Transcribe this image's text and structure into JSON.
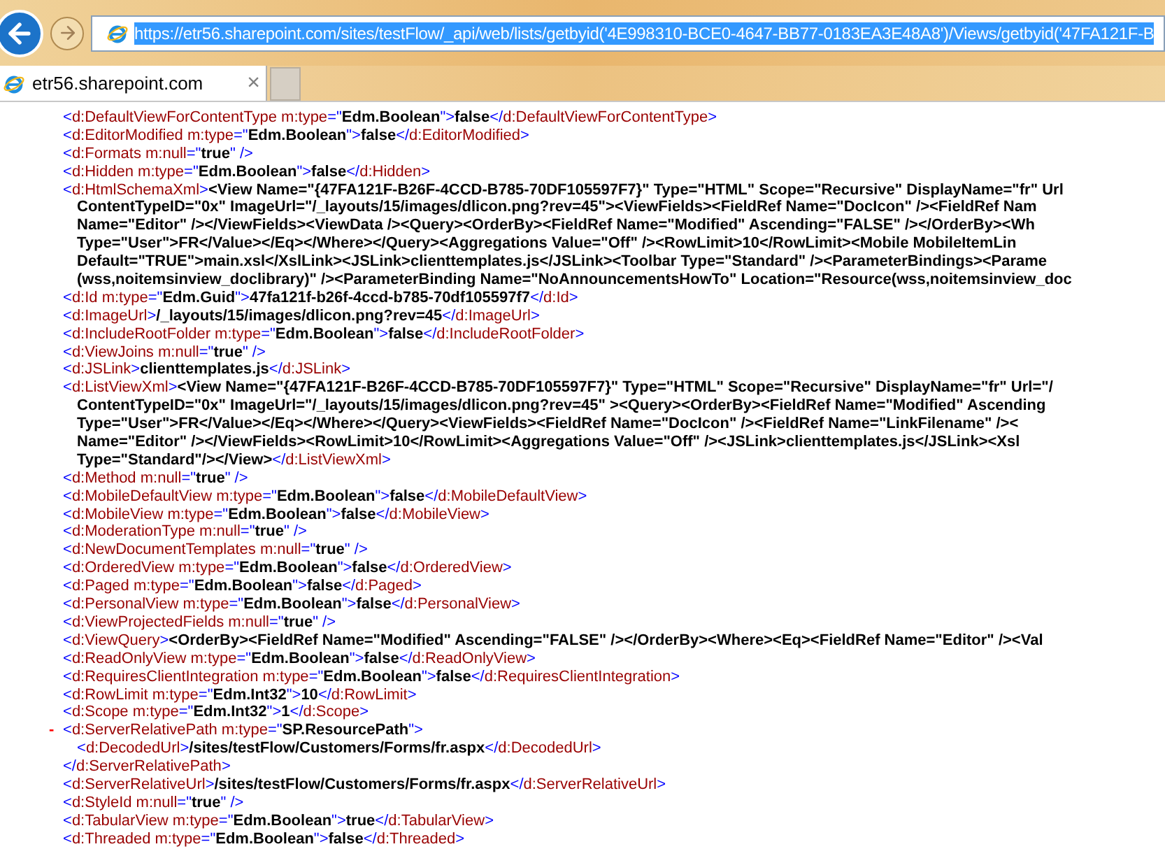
{
  "address_bar": {
    "url": "https://etr56.sharepoint.com/sites/testFlow/_api/web/lists/getbyid('4E998310-BCE0-4647-BB77-0183EA3E48A8')/Views/getbyid('47FA121F-B",
    "selected": true
  },
  "tabs": [
    {
      "title": "etr56.sharepoint.com",
      "close": "×",
      "selected": true
    }
  ],
  "xml_lines": [
    {
      "tokens": [
        {
          "kind": "markup",
          "text": "<"
        },
        {
          "kind": "name",
          "text": "d:DefaultViewForContentType m:type"
        },
        {
          "kind": "markup",
          "text": "=\""
        },
        {
          "kind": "value",
          "text": "Edm.Boolean"
        },
        {
          "kind": "markup",
          "text": "\">"
        },
        {
          "kind": "value",
          "text": "false"
        },
        {
          "kind": "markup",
          "text": "</"
        },
        {
          "kind": "name",
          "text": "d:DefaultViewForContentType"
        },
        {
          "kind": "markup",
          "text": ">"
        }
      ]
    },
    {
      "tokens": [
        {
          "kind": "markup",
          "text": "<"
        },
        {
          "kind": "name",
          "text": "d:EditorModified m:type"
        },
        {
          "kind": "markup",
          "text": "=\""
        },
        {
          "kind": "value",
          "text": "Edm.Boolean"
        },
        {
          "kind": "markup",
          "text": "\">"
        },
        {
          "kind": "value",
          "text": "false"
        },
        {
          "kind": "markup",
          "text": "</"
        },
        {
          "kind": "name",
          "text": "d:EditorModified"
        },
        {
          "kind": "markup",
          "text": ">"
        }
      ]
    },
    {
      "tokens": [
        {
          "kind": "markup",
          "text": "<"
        },
        {
          "kind": "name",
          "text": "d:Formats m:null"
        },
        {
          "kind": "markup",
          "text": "=\""
        },
        {
          "kind": "value",
          "text": "true"
        },
        {
          "kind": "markup",
          "text": "\" />"
        }
      ]
    },
    {
      "tokens": [
        {
          "kind": "markup",
          "text": "<"
        },
        {
          "kind": "name",
          "text": "d:Hidden m:type"
        },
        {
          "kind": "markup",
          "text": "=\""
        },
        {
          "kind": "value",
          "text": "Edm.Boolean"
        },
        {
          "kind": "markup",
          "text": "\">"
        },
        {
          "kind": "value",
          "text": "false"
        },
        {
          "kind": "markup",
          "text": "</"
        },
        {
          "kind": "name",
          "text": "d:Hidden"
        },
        {
          "kind": "markup",
          "text": ">"
        }
      ]
    },
    {
      "tokens": [
        {
          "kind": "markup",
          "text": "<"
        },
        {
          "kind": "name",
          "text": "d:HtmlSchemaXml"
        },
        {
          "kind": "markup",
          "text": ">"
        },
        {
          "kind": "value",
          "text": "<View Name=\"{47FA121F-B26F-4CCD-B785-70DF105597F7}\" Type=\"HTML\" Scope=\"Recursive\" DisplayName=\"fr\" Url"
        }
      ],
      "children": [
        {
          "tokens": [
            {
              "kind": "value",
              "text": "ContentTypeID=\"0x\" ImageUrl=\"/_layouts/15/images/dlicon.png?rev=45\"><ViewFields><FieldRef Name=\"DocIcon\" /><FieldRef Nam"
            }
          ]
        },
        {
          "tokens": [
            {
              "kind": "value",
              "text": "Name=\"Editor\" /></ViewFields><ViewData /><Query><OrderBy><FieldRef Name=\"Modified\" Ascending=\"FALSE\" /></OrderBy><Wh"
            }
          ]
        },
        {
          "tokens": [
            {
              "kind": "value",
              "text": "Type=\"User\">FR</Value></Eq></Where></Query><Aggregations Value=\"Off\" /><RowLimit>10</RowLimit><Mobile MobileItemLin"
            }
          ]
        },
        {
          "tokens": [
            {
              "kind": "value",
              "text": "Default=\"TRUE\">main.xsl</XslLink><JSLink>clienttemplates.js</JSLink><Toolbar Type=\"Standard\" /><ParameterBindings><Parame"
            }
          ]
        },
        {
          "tokens": [
            {
              "kind": "value",
              "text": "(wss,noitemsinview_doclibrary)\" /><ParameterBinding Name=\"NoAnnouncementsHowTo\" Location=\"Resource(wss,noitemsinview_doc"
            }
          ]
        }
      ]
    },
    {
      "tokens": [
        {
          "kind": "markup",
          "text": "<"
        },
        {
          "kind": "name",
          "text": "d:Id m:type"
        },
        {
          "kind": "markup",
          "text": "=\""
        },
        {
          "kind": "value",
          "text": "Edm.Guid"
        },
        {
          "kind": "markup",
          "text": "\">"
        },
        {
          "kind": "value",
          "text": "47fa121f-b26f-4ccd-b785-70df105597f7"
        },
        {
          "kind": "markup",
          "text": "</"
        },
        {
          "kind": "name",
          "text": "d:Id"
        },
        {
          "kind": "markup",
          "text": ">"
        }
      ]
    },
    {
      "tokens": [
        {
          "kind": "markup",
          "text": "<"
        },
        {
          "kind": "name",
          "text": "d:ImageUrl"
        },
        {
          "kind": "markup",
          "text": ">"
        },
        {
          "kind": "value",
          "text": "/_layouts/15/images/dlicon.png?rev=45"
        },
        {
          "kind": "markup",
          "text": "</"
        },
        {
          "kind": "name",
          "text": "d:ImageUrl"
        },
        {
          "kind": "markup",
          "text": ">"
        }
      ]
    },
    {
      "tokens": [
        {
          "kind": "markup",
          "text": "<"
        },
        {
          "kind": "name",
          "text": "d:IncludeRootFolder m:type"
        },
        {
          "kind": "markup",
          "text": "=\""
        },
        {
          "kind": "value",
          "text": "Edm.Boolean"
        },
        {
          "kind": "markup",
          "text": "\">"
        },
        {
          "kind": "value",
          "text": "false"
        },
        {
          "kind": "markup",
          "text": "</"
        },
        {
          "kind": "name",
          "text": "d:IncludeRootFolder"
        },
        {
          "kind": "markup",
          "text": ">"
        }
      ]
    },
    {
      "tokens": [
        {
          "kind": "markup",
          "text": "<"
        },
        {
          "kind": "name",
          "text": "d:ViewJoins m:null"
        },
        {
          "kind": "markup",
          "text": "=\""
        },
        {
          "kind": "value",
          "text": "true"
        },
        {
          "kind": "markup",
          "text": "\" />"
        }
      ]
    },
    {
      "tokens": [
        {
          "kind": "markup",
          "text": "<"
        },
        {
          "kind": "name",
          "text": "d:JSLink"
        },
        {
          "kind": "markup",
          "text": ">"
        },
        {
          "kind": "value",
          "text": "clienttemplates.js"
        },
        {
          "kind": "markup",
          "text": "</"
        },
        {
          "kind": "name",
          "text": "d:JSLink"
        },
        {
          "kind": "markup",
          "text": ">"
        }
      ]
    },
    {
      "tokens": [
        {
          "kind": "markup",
          "text": "<"
        },
        {
          "kind": "name",
          "text": "d:ListViewXml"
        },
        {
          "kind": "markup",
          "text": ">"
        },
        {
          "kind": "value",
          "text": "<View Name=\"{47FA121F-B26F-4CCD-B785-70DF105597F7}\" Type=\"HTML\" Scope=\"Recursive\" DisplayName=\"fr\" Url=\"/"
        }
      ],
      "children": [
        {
          "tokens": [
            {
              "kind": "value",
              "text": "ContentTypeID=\"0x\" ImageUrl=\"/_layouts/15/images/dlicon.png?rev=45\" ><Query><OrderBy><FieldRef Name=\"Modified\" Ascending"
            }
          ]
        },
        {
          "tokens": [
            {
              "kind": "value",
              "text": "Type=\"User\">FR</Value></Eq></Where></Query><ViewFields><FieldRef Name=\"DocIcon\" /><FieldRef Name=\"LinkFilename\" /><"
            }
          ]
        },
        {
          "tokens": [
            {
              "kind": "value",
              "text": "Name=\"Editor\" /></ViewFields><RowLimit>10</RowLimit><Aggregations Value=\"Off\" /><JSLink>clienttemplates.js</JSLink><Xsl"
            }
          ]
        },
        {
          "tokens": [
            {
              "kind": "value",
              "text": "Type=\"Standard\"/></View>"
            },
            {
              "kind": "markup",
              "text": "</"
            },
            {
              "kind": "name",
              "text": "d:ListViewXml"
            },
            {
              "kind": "markup",
              "text": ">"
            }
          ]
        }
      ]
    },
    {
      "tokens": [
        {
          "kind": "markup",
          "text": "<"
        },
        {
          "kind": "name",
          "text": "d:Method m:null"
        },
        {
          "kind": "markup",
          "text": "=\""
        },
        {
          "kind": "value",
          "text": "true"
        },
        {
          "kind": "markup",
          "text": "\" />"
        }
      ]
    },
    {
      "tokens": [
        {
          "kind": "markup",
          "text": "<"
        },
        {
          "kind": "name",
          "text": "d:MobileDefaultView m:type"
        },
        {
          "kind": "markup",
          "text": "=\""
        },
        {
          "kind": "value",
          "text": "Edm.Boolean"
        },
        {
          "kind": "markup",
          "text": "\">"
        },
        {
          "kind": "value",
          "text": "false"
        },
        {
          "kind": "markup",
          "text": "</"
        },
        {
          "kind": "name",
          "text": "d:MobileDefaultView"
        },
        {
          "kind": "markup",
          "text": ">"
        }
      ]
    },
    {
      "tokens": [
        {
          "kind": "markup",
          "text": "<"
        },
        {
          "kind": "name",
          "text": "d:MobileView m:type"
        },
        {
          "kind": "markup",
          "text": "=\""
        },
        {
          "kind": "value",
          "text": "Edm.Boolean"
        },
        {
          "kind": "markup",
          "text": "\">"
        },
        {
          "kind": "value",
          "text": "false"
        },
        {
          "kind": "markup",
          "text": "</"
        },
        {
          "kind": "name",
          "text": "d:MobileView"
        },
        {
          "kind": "markup",
          "text": ">"
        }
      ]
    },
    {
      "tokens": [
        {
          "kind": "markup",
          "text": "<"
        },
        {
          "kind": "name",
          "text": "d:ModerationType m:null"
        },
        {
          "kind": "markup",
          "text": "=\""
        },
        {
          "kind": "value",
          "text": "true"
        },
        {
          "kind": "markup",
          "text": "\" />"
        }
      ]
    },
    {
      "tokens": [
        {
          "kind": "markup",
          "text": "<"
        },
        {
          "kind": "name",
          "text": "d:NewDocumentTemplates m:null"
        },
        {
          "kind": "markup",
          "text": "=\""
        },
        {
          "kind": "value",
          "text": "true"
        },
        {
          "kind": "markup",
          "text": "\" />"
        }
      ]
    },
    {
      "tokens": [
        {
          "kind": "markup",
          "text": "<"
        },
        {
          "kind": "name",
          "text": "d:OrderedView m:type"
        },
        {
          "kind": "markup",
          "text": "=\""
        },
        {
          "kind": "value",
          "text": "Edm.Boolean"
        },
        {
          "kind": "markup",
          "text": "\">"
        },
        {
          "kind": "value",
          "text": "false"
        },
        {
          "kind": "markup",
          "text": "</"
        },
        {
          "kind": "name",
          "text": "d:OrderedView"
        },
        {
          "kind": "markup",
          "text": ">"
        }
      ]
    },
    {
      "tokens": [
        {
          "kind": "markup",
          "text": "<"
        },
        {
          "kind": "name",
          "text": "d:Paged m:type"
        },
        {
          "kind": "markup",
          "text": "=\""
        },
        {
          "kind": "value",
          "text": "Edm.Boolean"
        },
        {
          "kind": "markup",
          "text": "\">"
        },
        {
          "kind": "value",
          "text": "false"
        },
        {
          "kind": "markup",
          "text": "</"
        },
        {
          "kind": "name",
          "text": "d:Paged"
        },
        {
          "kind": "markup",
          "text": ">"
        }
      ]
    },
    {
      "tokens": [
        {
          "kind": "markup",
          "text": "<"
        },
        {
          "kind": "name",
          "text": "d:PersonalView m:type"
        },
        {
          "kind": "markup",
          "text": "=\""
        },
        {
          "kind": "value",
          "text": "Edm.Boolean"
        },
        {
          "kind": "markup",
          "text": "\">"
        },
        {
          "kind": "value",
          "text": "false"
        },
        {
          "kind": "markup",
          "text": "</"
        },
        {
          "kind": "name",
          "text": "d:PersonalView"
        },
        {
          "kind": "markup",
          "text": ">"
        }
      ]
    },
    {
      "tokens": [
        {
          "kind": "markup",
          "text": "<"
        },
        {
          "kind": "name",
          "text": "d:ViewProjectedFields m:null"
        },
        {
          "kind": "markup",
          "text": "=\""
        },
        {
          "kind": "value",
          "text": "true"
        },
        {
          "kind": "markup",
          "text": "\" />"
        }
      ]
    },
    {
      "tokens": [
        {
          "kind": "markup",
          "text": "<"
        },
        {
          "kind": "name",
          "text": "d:ViewQuery"
        },
        {
          "kind": "markup",
          "text": ">"
        },
        {
          "kind": "value",
          "text": "<OrderBy><FieldRef Name=\"Modified\" Ascending=\"FALSE\" /></OrderBy><Where><Eq><FieldRef Name=\"Editor\" /><Val"
        }
      ]
    },
    {
      "tokens": [
        {
          "kind": "markup",
          "text": "<"
        },
        {
          "kind": "name",
          "text": "d:ReadOnlyView m:type"
        },
        {
          "kind": "markup",
          "text": "=\""
        },
        {
          "kind": "value",
          "text": "Edm.Boolean"
        },
        {
          "kind": "markup",
          "text": "\">"
        },
        {
          "kind": "value",
          "text": "false"
        },
        {
          "kind": "markup",
          "text": "</"
        },
        {
          "kind": "name",
          "text": "d:ReadOnlyView"
        },
        {
          "kind": "markup",
          "text": ">"
        }
      ]
    },
    {
      "tokens": [
        {
          "kind": "markup",
          "text": "<"
        },
        {
          "kind": "name",
          "text": "d:RequiresClientIntegration m:type"
        },
        {
          "kind": "markup",
          "text": "=\""
        },
        {
          "kind": "value",
          "text": "Edm.Boolean"
        },
        {
          "kind": "markup",
          "text": "\">"
        },
        {
          "kind": "value",
          "text": "false"
        },
        {
          "kind": "markup",
          "text": "</"
        },
        {
          "kind": "name",
          "text": "d:RequiresClientIntegration"
        },
        {
          "kind": "markup",
          "text": ">"
        }
      ]
    },
    {
      "tokens": [
        {
          "kind": "markup",
          "text": "<"
        },
        {
          "kind": "name",
          "text": "d:RowLimit m:type"
        },
        {
          "kind": "markup",
          "text": "=\""
        },
        {
          "kind": "value",
          "text": "Edm.Int32"
        },
        {
          "kind": "markup",
          "text": "\">"
        },
        {
          "kind": "value",
          "text": "10"
        },
        {
          "kind": "markup",
          "text": "</"
        },
        {
          "kind": "name",
          "text": "d:RowLimit"
        },
        {
          "kind": "markup",
          "text": ">"
        }
      ]
    },
    {
      "tokens": [
        {
          "kind": "markup",
          "text": "<"
        },
        {
          "kind": "name",
          "text": "d:Scope m:type"
        },
        {
          "kind": "markup",
          "text": "=\""
        },
        {
          "kind": "value",
          "text": "Edm.Int32"
        },
        {
          "kind": "markup",
          "text": "\">"
        },
        {
          "kind": "value",
          "text": "1"
        },
        {
          "kind": "markup",
          "text": "</"
        },
        {
          "kind": "name",
          "text": "d:Scope"
        },
        {
          "kind": "markup",
          "text": ">"
        }
      ]
    },
    {
      "tokens": [
        {
          "kind": "toggle",
          "text": "-"
        },
        {
          "kind": "markup",
          "text": "<"
        },
        {
          "kind": "name",
          "text": "d:ServerRelativePath m:type"
        },
        {
          "kind": "markup",
          "text": "=\""
        },
        {
          "kind": "value",
          "text": "SP.ResourcePath"
        },
        {
          "kind": "markup",
          "text": "\">"
        }
      ],
      "children": [
        {
          "tokens": [
            {
              "kind": "markup",
              "text": "<"
            },
            {
              "kind": "name",
              "text": "d:DecodedUrl"
            },
            {
              "kind": "markup",
              "text": ">"
            },
            {
              "kind": "value",
              "text": "/sites/testFlow/Customers/Forms/fr.aspx"
            },
            {
              "kind": "markup",
              "text": "</"
            },
            {
              "kind": "name",
              "text": "d:DecodedUrl"
            },
            {
              "kind": "markup",
              "text": ">"
            }
          ]
        }
      ]
    },
    {
      "tokens": [
        {
          "kind": "markup",
          "text": "</"
        },
        {
          "kind": "name",
          "text": "d:ServerRelativePath"
        },
        {
          "kind": "markup",
          "text": ">"
        }
      ]
    },
    {
      "tokens": [
        {
          "kind": "markup",
          "text": "<"
        },
        {
          "kind": "name",
          "text": "d:ServerRelativeUrl"
        },
        {
          "kind": "markup",
          "text": ">"
        },
        {
          "kind": "value",
          "text": "/sites/testFlow/Customers/Forms/fr.aspx"
        },
        {
          "kind": "markup",
          "text": "</"
        },
        {
          "kind": "name",
          "text": "d:ServerRelativeUrl"
        },
        {
          "kind": "markup",
          "text": ">"
        }
      ]
    },
    {
      "tokens": [
        {
          "kind": "markup",
          "text": "<"
        },
        {
          "kind": "name",
          "text": "d:StyleId m:null"
        },
        {
          "kind": "markup",
          "text": "=\""
        },
        {
          "kind": "value",
          "text": "true"
        },
        {
          "kind": "markup",
          "text": "\" />"
        }
      ]
    },
    {
      "tokens": [
        {
          "kind": "markup",
          "text": "<"
        },
        {
          "kind": "name",
          "text": "d:TabularView m:type"
        },
        {
          "kind": "markup",
          "text": "=\""
        },
        {
          "kind": "value",
          "text": "Edm.Boolean"
        },
        {
          "kind": "markup",
          "text": "\">"
        },
        {
          "kind": "value",
          "text": "true"
        },
        {
          "kind": "markup",
          "text": "</"
        },
        {
          "kind": "name",
          "text": "d:TabularView"
        },
        {
          "kind": "markup",
          "text": ">"
        }
      ]
    },
    {
      "tokens": [
        {
          "kind": "markup",
          "text": "<"
        },
        {
          "kind": "name",
          "text": "d:Threaded m:type"
        },
        {
          "kind": "markup",
          "text": "=\""
        },
        {
          "kind": "value",
          "text": "Edm.Boolean"
        },
        {
          "kind": "markup",
          "text": "\">"
        },
        {
          "kind": "value",
          "text": "false"
        },
        {
          "kind": "markup",
          "text": "</"
        },
        {
          "kind": "name",
          "text": "d:Threaded"
        },
        {
          "kind": "markup",
          "text": ">"
        }
      ]
    }
  ]
}
